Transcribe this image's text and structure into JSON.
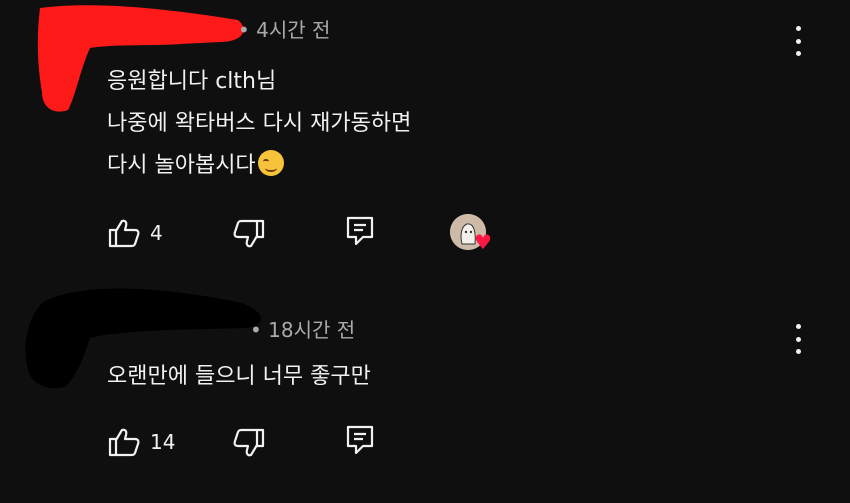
{
  "comments": [
    {
      "meta": "• 4시간 전",
      "lines": [
        "응원합니다 clth님",
        "나중에 왁타버스 다시 재가동하면",
        "다시 놀아봅시다"
      ],
      "emoji": "smiling-face",
      "likes": "4",
      "creator_heart": true
    },
    {
      "meta": "• 18시간 전",
      "lines": [
        "오랜만에 들으니 너무 좋구만"
      ],
      "likes": "14",
      "creator_heart": false
    }
  ],
  "colors": {
    "background": "#0f0f0f",
    "text": "#f1f1f1",
    "meta": "#aaaaaa",
    "redaction_red": "#ff1a1a",
    "redaction_black": "#000000",
    "heart": "#ff1744"
  },
  "icons": [
    "more-vert-icon",
    "thumb-up-icon",
    "thumb-down-icon",
    "reply-icon",
    "creator-heart-icon"
  ]
}
